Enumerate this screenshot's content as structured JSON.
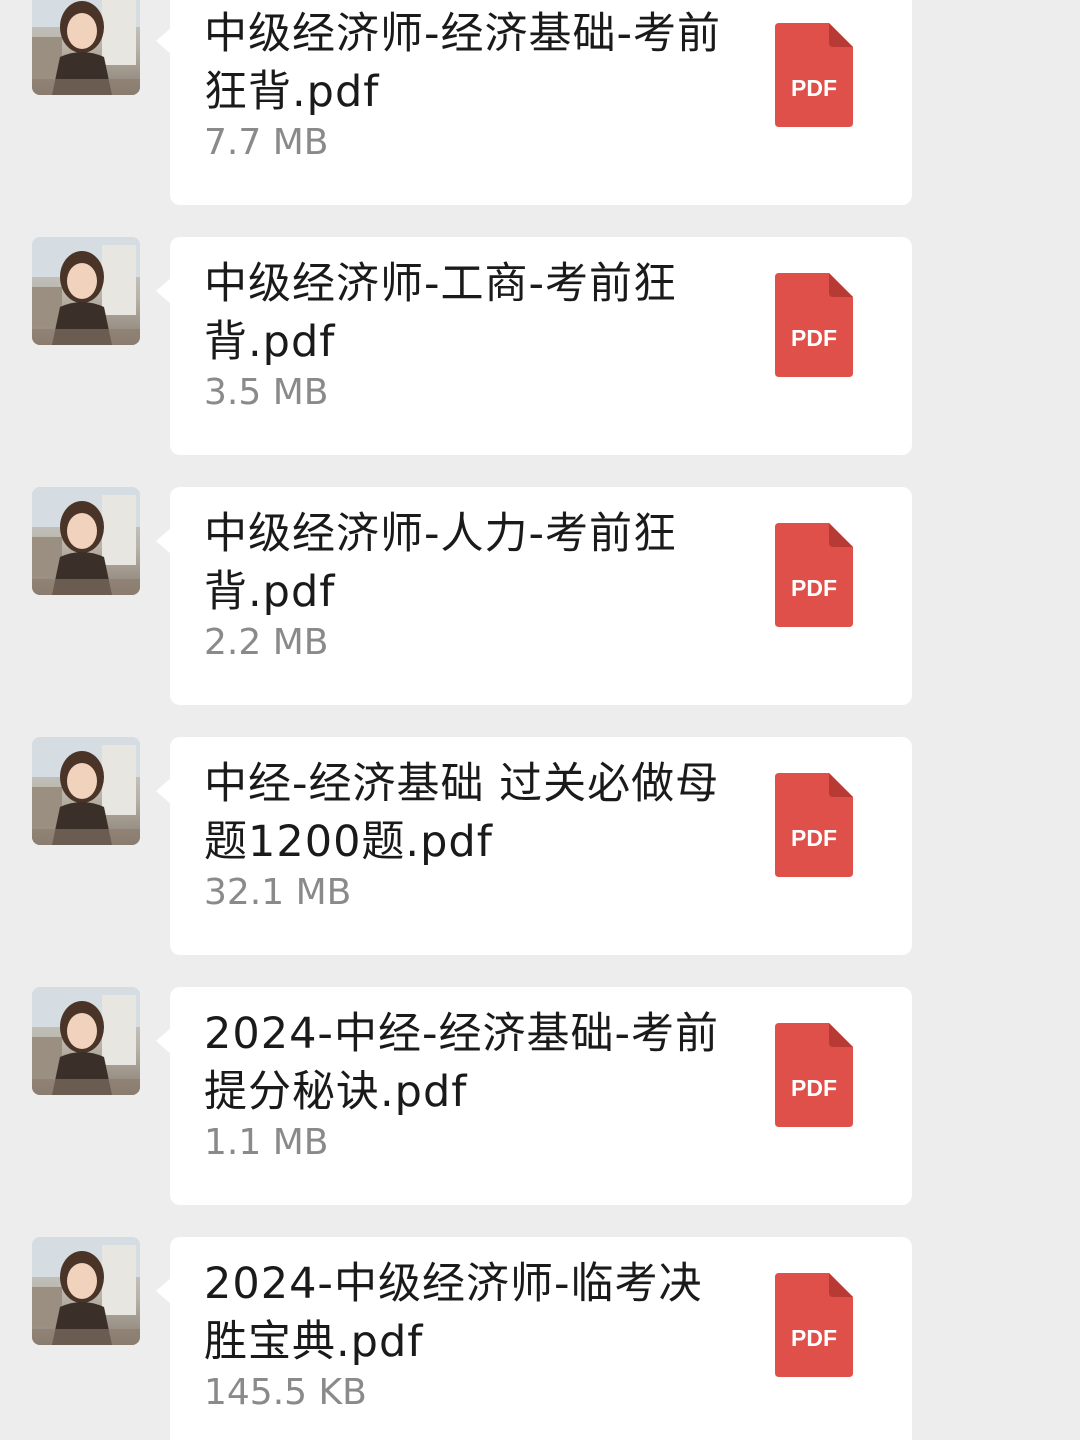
{
  "messages": [
    {
      "file_name": "中级经济师-经济基础-考前狂背.pdf",
      "file_size": "7.7 MB",
      "icon_label": "PDF"
    },
    {
      "file_name": "中级经济师-工商-考前狂背.pdf",
      "file_size": "3.5 MB",
      "icon_label": "PDF"
    },
    {
      "file_name": "中级经济师-人力-考前狂背.pdf",
      "file_size": "2.2 MB",
      "icon_label": "PDF"
    },
    {
      "file_name": "中经-经济基础 过关必做母题1200题.pdf",
      "file_size": "32.1 MB",
      "icon_label": "PDF"
    },
    {
      "file_name": "2024-中经-经济基础-考前提分秘诀.pdf",
      "file_size": "1.1 MB",
      "icon_label": "PDF"
    },
    {
      "file_name": "2024-中级经济师-临考决胜宝典.pdf",
      "file_size": "145.5 KB",
      "icon_label": "PDF"
    }
  ],
  "colors": {
    "background": "#ededed",
    "bubble": "#ffffff",
    "pdf_icon": "#e0504a",
    "file_size_text": "#8a8a8a"
  },
  "icons": {
    "avatar": "user-avatar-photo",
    "file": "pdf-file-icon"
  }
}
